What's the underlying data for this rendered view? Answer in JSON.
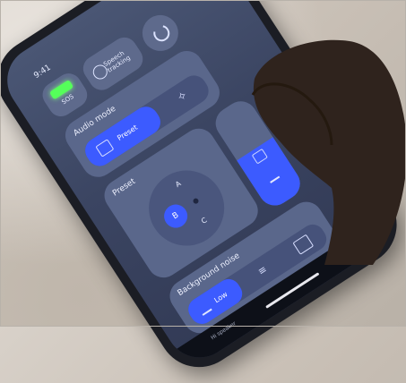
{
  "status": {
    "time": "9:41"
  },
  "controls": {
    "sos_label": "SOS",
    "speech_tracking_label": "Speech tracking",
    "power_icon": "power-icon"
  },
  "audio_mode": {
    "title": "Audio mode",
    "selected_label": "Preset",
    "alt_icon": "sparkle-icon"
  },
  "preset": {
    "title": "Preset",
    "options": [
      "A",
      "B",
      "C"
    ],
    "selected": "B"
  },
  "volume": {
    "level_fraction": 0.55,
    "minus_label": "−"
  },
  "background_noise": {
    "title": "Background noise",
    "selected_label": "Low"
  },
  "bottom_bar": {
    "hint_text": "Hi speaker"
  },
  "colors": {
    "accent": "#3c5bff",
    "sos_led": "#55ff5a",
    "screen_bg": "#3b4562",
    "card_bg": "#5a678b"
  }
}
